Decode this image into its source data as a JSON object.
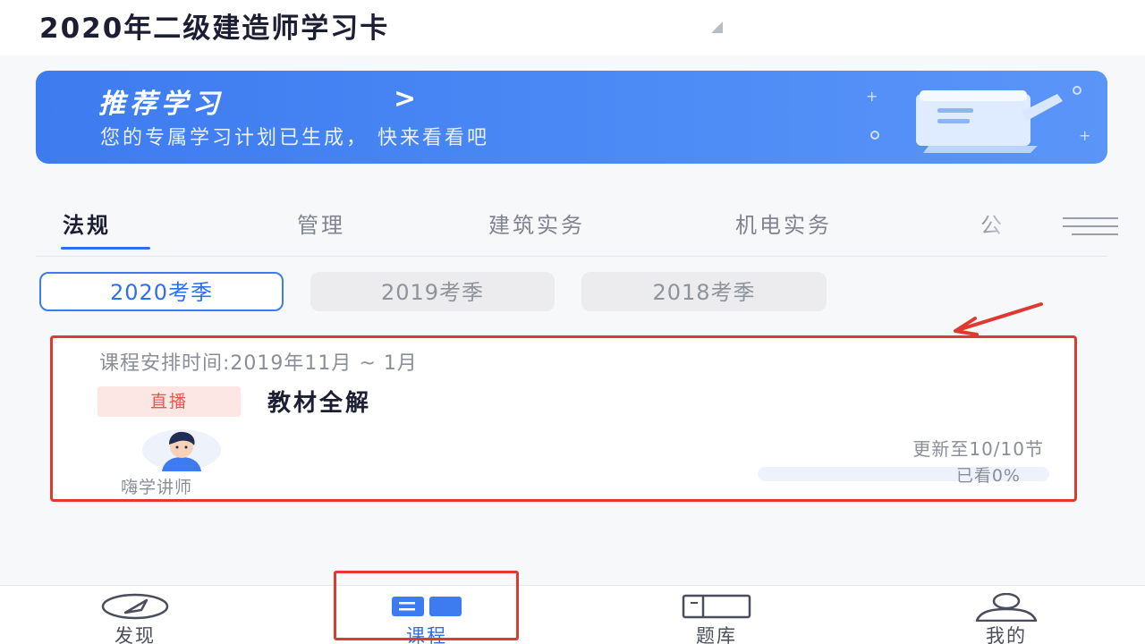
{
  "header": {
    "title": "2020年二级建造师学习卡"
  },
  "banner": {
    "title": "推荐学习",
    "arrow": ">",
    "subtitle": "您的专属学习计划已生成， 快来看看吧"
  },
  "tabs": [
    {
      "label": "法规",
      "active": true
    },
    {
      "label": "管理",
      "active": false
    },
    {
      "label": "建筑实务",
      "active": false
    },
    {
      "label": "机电实务",
      "active": false
    },
    {
      "label": "公",
      "active": false
    }
  ],
  "seasons": [
    {
      "label": "2020考季",
      "active": true
    },
    {
      "label": "2019考季",
      "active": false
    },
    {
      "label": "2018考季",
      "active": false
    }
  ],
  "course": {
    "schedule": "课程安排时间:2019年11月 ~ 1月",
    "badge": "直播",
    "name": "教材全解",
    "teacher": "嗨学讲师",
    "update": "更新至10/10节",
    "watched": "已看0%",
    "progress_percent": 0
  },
  "bottom_nav": [
    {
      "label": "发现",
      "icon": "compass-icon",
      "active": false
    },
    {
      "label": "课程",
      "icon": "book-icon",
      "active": true
    },
    {
      "label": "题库",
      "icon": "question-bank-icon",
      "active": false
    },
    {
      "label": "我的",
      "icon": "user-icon",
      "active": false
    }
  ],
  "colors": {
    "accent": "#3d7bf0",
    "annotation": "#e03a30",
    "live_badge_bg": "#fde7e5"
  }
}
